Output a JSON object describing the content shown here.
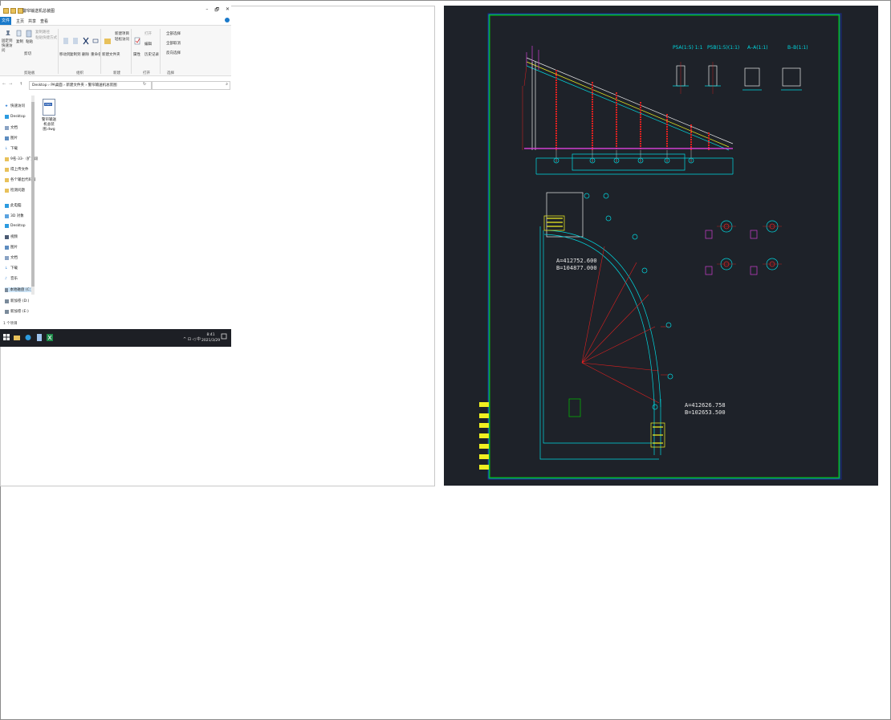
{
  "explorer": {
    "window_title": "警帘输送机总装图",
    "controls": {
      "minimize": "–",
      "maximize": "🗗",
      "close": "✕"
    },
    "menu": {
      "file": "文件",
      "home": "主页",
      "share": "共享",
      "view": "查看"
    },
    "ribbon": {
      "pin_quick": "固定到快速访问",
      "copy": "复制",
      "paste": "粘贴",
      "copy_path": "复制路径",
      "paste_shortcut": "粘贴快捷方式",
      "cut": "剪切",
      "clipboard_group": "剪贴板",
      "move_to": "移动到",
      "copy_to": "复制到",
      "delete": "删除",
      "rename": "重命名",
      "organize_group": "组织",
      "new_folder": "新建文件夹",
      "new_item": "新建项目",
      "easy_access": "轻松访问",
      "new_group": "新建",
      "properties": "属性",
      "open": "打开",
      "edit": "编辑",
      "history": "历史记录",
      "open_group": "打开",
      "select_all": "全部选择",
      "select_none": "全部取消",
      "invert_selection": "反向选择",
      "select_group": "选择"
    },
    "address": {
      "path_1": "Desktop",
      "path_2": "PA桌面",
      "path_3": "新建文件夹",
      "path_4": "警帘输送机总装图"
    },
    "nav": {
      "quick_access": "快速访问",
      "desktop": "Desktop",
      "documents": "文档",
      "pictures": "图片",
      "downloads": "下载",
      "folder_a": "9名-33-（扩大段",
      "folder_b": "得上传文件",
      "folder_c": "各个输出代码服",
      "folder_d": "检测问题",
      "this_pc": "此电脑",
      "objects3d": "3D 对象",
      "pc_desktop": "Desktop",
      "videos": "视频",
      "pc_pictures": "图片",
      "pc_documents": "文档",
      "pc_downloads": "下载",
      "music": "音乐",
      "local_disk": "本地磁盘 (C:)",
      "new_volume_d": "新加卷 (D:)",
      "new_volume_e": "新加卷 (E:)"
    },
    "file": {
      "name": "警帘输送机总装图.dwg",
      "badge": "DWG"
    },
    "status": "1 个项目",
    "taskbar": {
      "time": "8:41",
      "date": "2021/3/29"
    }
  },
  "cad": {
    "title_labels": [
      "P5A(1:5) 1:1",
      "P5B(1:5)(1:1)",
      "A–A(1:1)",
      "B–B(1:1)"
    ],
    "coord_1": {
      "a": "A=412752.600",
      "b": "B=104877.000"
    },
    "coord_2": {
      "a": "A=412626.758",
      "b": "B=102653.500"
    },
    "colors": {
      "bg": "#1e2229",
      "border": "#00c400",
      "cyan": "#00d8e0",
      "red": "#e02020",
      "magenta": "#d040d0",
      "yellow": "#f0f020",
      "white": "#e8e8e8"
    }
  }
}
